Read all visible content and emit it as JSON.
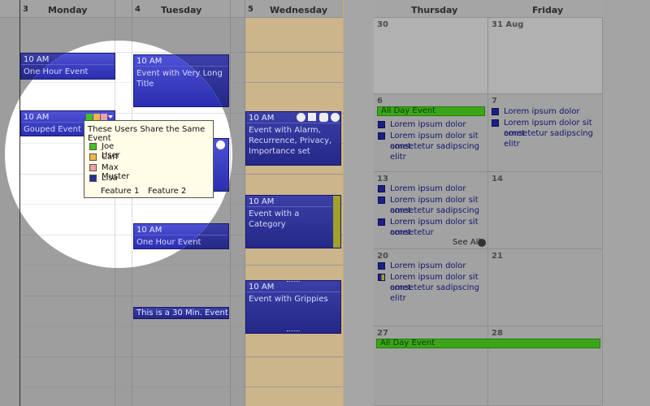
{
  "colors": {
    "event_blue": "#2a2e93",
    "all_day_green": "#3ba51a",
    "wednesday_highlight": "#ccb58b",
    "popup_bg": "#fffce8"
  },
  "week": {
    "days": [
      {
        "num": "3",
        "name": "Monday"
      },
      {
        "num": "4",
        "name": "Tuesday"
      },
      {
        "num": "5",
        "name": "Wednesday"
      }
    ],
    "events": {
      "mon_one_hour": {
        "time": "10 AM",
        "title": "One Hour Event"
      },
      "mon_grouped": {
        "time": "10 AM",
        "title": "Gouped Event"
      },
      "tue_long": {
        "time": "10 AM",
        "title": "Event with Very Long Title"
      },
      "tue_one_hour": {
        "time": "10 AM",
        "title": "One Hour Event"
      },
      "tue_30min": {
        "title": "This is a 30 Min. Event"
      },
      "wed_alarm": {
        "time": "10 AM",
        "title": "Event with Alarm, Recurrence, Privacy, Importance set"
      },
      "wed_category": {
        "time": "10 AM",
        "title": "Event with a Category"
      },
      "wed_grippies": {
        "time": "10 AM",
        "title": "Event with Grippies"
      }
    }
  },
  "popup": {
    "title": "These Users Share the Same Event",
    "users": [
      {
        "name": "Joe User",
        "color": "#44c21f"
      },
      {
        "name": "Carl",
        "color": "#f2b64a"
      },
      {
        "name": "Max Muster",
        "color": "#f0a1a1"
      },
      {
        "name": "Lisa",
        "color": "#2a2e93"
      }
    ],
    "features": [
      "Feature 1",
      "Feature 2"
    ]
  },
  "month": {
    "headers": {
      "thursday": "Thursday",
      "friday": "Friday"
    },
    "dates": {
      "d30": "30",
      "d31": "31 Aug",
      "d6": "6",
      "d7": "7",
      "d13": "13",
      "d14": "14",
      "d20": "20",
      "d21": "21",
      "d27": "27",
      "d28": "28"
    },
    "items": {
      "all_day_6": "All Day Event",
      "all_day_27": "All Day Event",
      "lorem_short": "Lorem ipsum dolor",
      "lorem_long": "Lorem ipsum dolor sit amet consetetur sadipscing elitr",
      "lorem_long_a": "Lorem ipsum dolor sit amet",
      "lorem_long_b": "consetetur sadipscing elitr",
      "lorem_13_3a": "Lorem ipsum dolor sit amet",
      "lorem_13_3b": "consetetur",
      "lorem_13_2a": "Lorem ipsum dolor sit amet",
      "lorem_13_2b": "consetetur sadipscing",
      "see_all": "See All"
    }
  }
}
